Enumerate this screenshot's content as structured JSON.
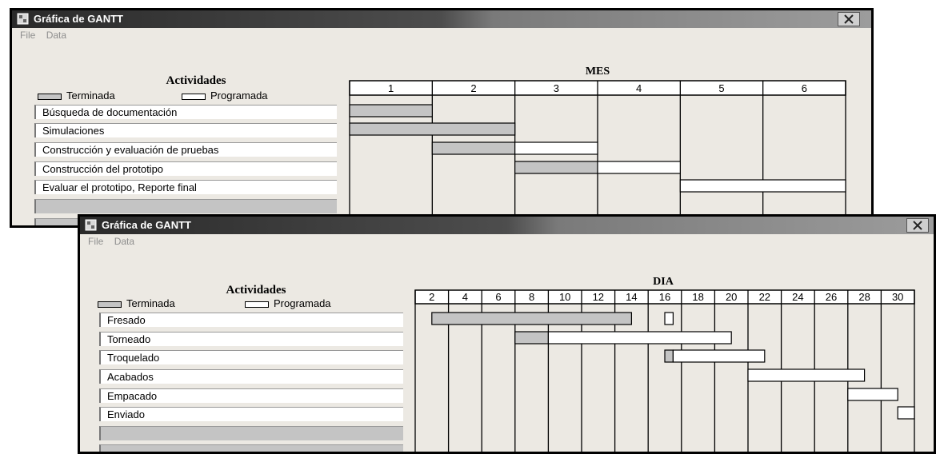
{
  "windows": [
    {
      "id": "w1",
      "title": "Gráfica de GANTT",
      "menu": [
        "File",
        "Data"
      ],
      "activities_title": "Actividades",
      "legend": {
        "completed": "Terminada",
        "scheduled": "Programada"
      },
      "activities": [
        "Búsqueda de documentación",
        "Simulaciones",
        "Construcción y evaluación de pruebas",
        "Construcción del prototipo",
        "Evaluar el prototipo, Reporte final"
      ],
      "empty_rows": 2,
      "chart_data": {
        "type": "gantt",
        "title": "MES",
        "categories": [
          "1",
          "2",
          "3",
          "4",
          "5",
          "6"
        ],
        "tasks": [
          {
            "name": "Búsqueda de documentación",
            "bars": [
              {
                "status": "Terminada",
                "start": 1,
                "end": 1
              }
            ]
          },
          {
            "name": "Simulaciones",
            "bars": [
              {
                "status": "Terminada",
                "start": 1,
                "end": 2
              }
            ]
          },
          {
            "name": "Construcción y evaluación de pruebas",
            "bars": [
              {
                "status": "Terminada",
                "start": 2,
                "end": 2
              },
              {
                "status": "Programada",
                "start": 3,
                "end": 3
              }
            ]
          },
          {
            "name": "Construcción del prototipo",
            "bars": [
              {
                "status": "Terminada",
                "start": 3,
                "end": 3
              },
              {
                "status": "Programada",
                "start": 4,
                "end": 4
              }
            ]
          },
          {
            "name": "Evaluar el prototipo, Reporte final",
            "bars": [
              {
                "status": "Programada",
                "start": 5,
                "end": 6
              }
            ]
          }
        ]
      }
    },
    {
      "id": "w2",
      "title": "Gráfica de GANTT",
      "menu": [
        "File",
        "Data"
      ],
      "activities_title": "Actividades",
      "legend": {
        "completed": "Terminada",
        "scheduled": "Programada"
      },
      "activities": [
        "Fresado",
        "Torneado",
        "Troquelado",
        "Acabados",
        "Empacado",
        "Enviado"
      ],
      "empty_rows": 2,
      "chart_data": {
        "type": "gantt",
        "title": "DIA",
        "categories": [
          "2",
          "4",
          "6",
          "8",
          "10",
          "12",
          "14",
          "16",
          "18",
          "20",
          "22",
          "24",
          "26",
          "28",
          "30"
        ],
        "tasks": [
          {
            "name": "Fresado",
            "bars": [
              {
                "status": "Terminada",
                "start": 2,
                "end": 14
              },
              {
                "status": "Programada",
                "start": 16,
                "end": 16.5
              }
            ]
          },
          {
            "name": "Torneado",
            "bars": [
              {
                "status": "Terminada",
                "start": 7,
                "end": 9
              },
              {
                "status": "Programada",
                "start": 9,
                "end": 20
              }
            ]
          },
          {
            "name": "Troquelado",
            "bars": [
              {
                "status": "Terminada",
                "start": 16,
                "end": 16.5
              },
              {
                "status": "Programada",
                "start": 16.5,
                "end": 22
              }
            ]
          },
          {
            "name": "Acabados",
            "bars": [
              {
                "status": "Programada",
                "start": 21,
                "end": 28
              }
            ]
          },
          {
            "name": "Empacado",
            "bars": [
              {
                "status": "Programada",
                "start": 27,
                "end": 30
              }
            ]
          },
          {
            "name": "Enviado",
            "bars": [
              {
                "status": "Programada",
                "start": 30,
                "end": 31
              }
            ]
          }
        ]
      }
    }
  ],
  "colors": {
    "completed": "#c4c4c4",
    "scheduled": "#ffffff",
    "grid": "#000000"
  }
}
